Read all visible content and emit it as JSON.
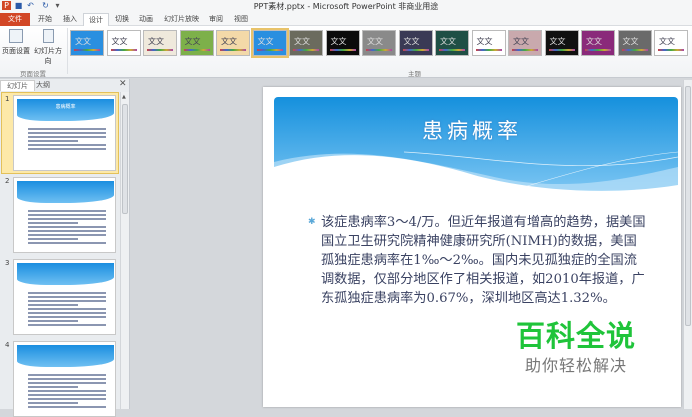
{
  "window": {
    "title": "PPT素材.pptx - Microsoft PowerPoint 非商业用途"
  },
  "quick_access": [
    "save-icon",
    "undo-icon",
    "redo-icon",
    "customize-icon"
  ],
  "tabs": [
    {
      "label": "文件"
    },
    {
      "label": "开始"
    },
    {
      "label": "插入"
    },
    {
      "label": "设计",
      "active": true
    },
    {
      "label": "切换"
    },
    {
      "label": "动画"
    },
    {
      "label": "幻灯片放映"
    },
    {
      "label": "审阅"
    },
    {
      "label": "视图"
    }
  ],
  "ribbon": {
    "page_setup": {
      "page_setup_label": "页面设置",
      "orientation_label": "幻灯片方向",
      "group_label": "页面设置"
    },
    "themes": {
      "group_label": "主题",
      "sample_text": "文文",
      "colors": [
        "#2a8fe0",
        "#ffffff",
        "#efe9dc",
        "#7db04a",
        "#f3d9a8",
        "#2a8fe0",
        "#6b6b5e",
        "#0b0b0b",
        "#8a8a8a",
        "#3a3a55",
        "#1f4f45",
        "#ffffff",
        "#c9a9ad",
        "#111111",
        "#8a2a7a",
        "#6a6a6a",
        "#ffffff"
      ],
      "selected_index": 5
    }
  },
  "left_panel": {
    "tabs": [
      "幻灯片",
      "大纲"
    ],
    "close_icon": "close-icon",
    "slides": [
      {
        "number": "1",
        "title": "患病概率",
        "selected": true
      },
      {
        "number": "2"
      },
      {
        "number": "3"
      },
      {
        "number": "4"
      }
    ]
  },
  "slide": {
    "title": "患病概率",
    "body": "该症患病率3～4/万。但近年报道有增高的趋势，据美国国立卫生研究院精神健康研究所(NIMH)的数据，美国孤独症患病率在1‰～2‰。国内未见孤独症的全国流调数据，仅部分地区作了相关报道，如2010年报道，广东孤独症患病率为0.67%，深圳地区高达1.32%。"
  },
  "watermark": {
    "brand": "百科全说",
    "slogan": "助你轻松解决"
  }
}
